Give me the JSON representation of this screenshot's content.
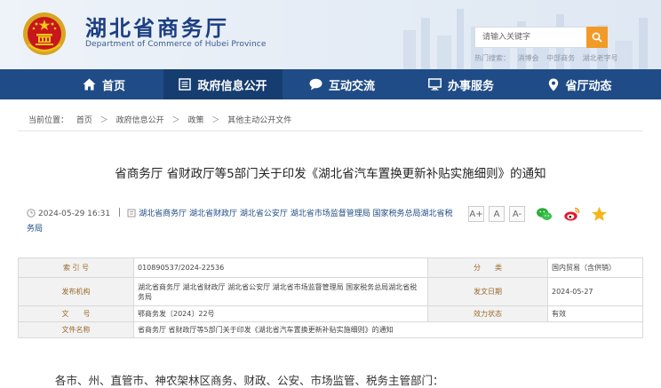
{
  "header": {
    "site_title": "湖北省商务厅",
    "site_subtitle": "Department of Commerce of Hubei Province",
    "search_placeholder": "请输入关键字",
    "hot_label": "热门搜索：",
    "hot_words": [
      "消博会",
      "中部商务",
      "湖北老字号"
    ]
  },
  "nav": {
    "items": [
      {
        "label": "首页",
        "icon": "home-icon"
      },
      {
        "label": "政府信息公开",
        "icon": "document-list-icon",
        "active": true
      },
      {
        "label": "互动交流",
        "icon": "chat-bubble-icon"
      },
      {
        "label": "办事服务",
        "icon": "monitor-icon"
      },
      {
        "label": "省厅动态",
        "icon": "location-pin-icon"
      }
    ]
  },
  "breadcrumb": {
    "current_label": "当前位置：",
    "items": [
      "首页",
      "政府信息公开",
      "政策",
      "其他主动公开文件"
    ],
    "separator": "＞"
  },
  "article": {
    "title": "省商务厅 省财政厅等5部门关于印发《湖北省汽车置换更新补贴实施细则》的通知",
    "datetime": "2024-05-29 16:31",
    "sources_line1": "湖北省商务厅  湖北省财政厅  湖北省公安厅  湖北省市场监督管理局  国家税务总局湖北省税",
    "sources_line2": "务局",
    "font_sizes": [
      "A+",
      "A",
      "A-"
    ],
    "share_icons": [
      "wechat-icon",
      "weibo-icon",
      "favorite-star-icon"
    ],
    "body_first_line": "各市、州、直管市、神农架林区商务、财政、公安、市场监管、税务主管部门："
  },
  "info_table": {
    "index_label": "索 引 号",
    "index_value": "010890537/2024-22536",
    "category_label": "分　　类",
    "category_value": "国内贸易（含供销）",
    "issuer_label": "发布机构",
    "issuer_value": "湖北省商务厅 湖北省财政厅 湖北省公安厅 湖北省市场监督管理局 国家税务总局湖北省税务局",
    "date_label": "发文日期",
    "date_value": "2024-05-27",
    "docno_label": "文　　号",
    "docno_value": "鄂商务发〔2024〕22号",
    "status_label": "效力状态",
    "status_value": "有效",
    "name_label": "文件名称",
    "name_value": "省商务厅 省财政厅等5部门关于印发《湖北省汽车置换更新补贴实施细则》的通知"
  },
  "colors": {
    "nav_bg": "#1f4c86",
    "nav_active_bg": "#163d6f",
    "title_blue": "#1c3f82",
    "search_button": "#f29a27",
    "table_key_text": "#9a6a2a"
  }
}
